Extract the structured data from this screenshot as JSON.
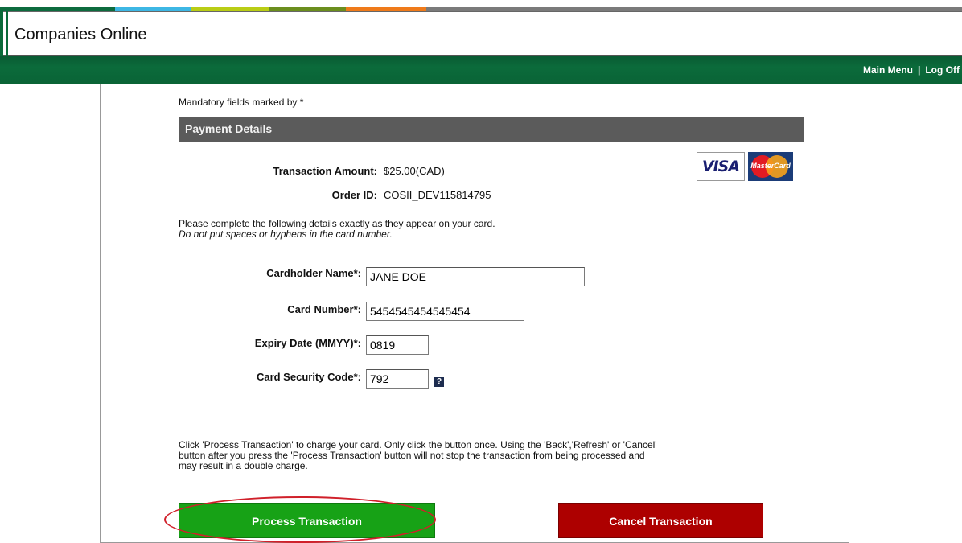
{
  "header": {
    "app_title": "Companies Online",
    "color_strip": [
      "#0d6b3e",
      "#3db7e4",
      "#b9cd15",
      "#6b8e1e",
      "#ef7a1a",
      "#7a7a7a"
    ]
  },
  "nav": {
    "main_menu": "Main Menu",
    "separator": "|",
    "log_off": "Log Off"
  },
  "form": {
    "mandatory_note": "Mandatory fields marked by *",
    "section_title": "Payment Details",
    "transaction_amount_label": "Transaction Amount:",
    "transaction_amount_value": "$25.00(CAD)",
    "order_id_label": "Order ID:",
    "order_id_value": "COSII_DEV115814795",
    "card_logos": [
      "VISA",
      "MasterCard"
    ],
    "instructions_line1": "Please complete the following details exactly as they appear on your card.",
    "instructions_line2": "Do not put spaces or hyphens in the card number.",
    "fields": [
      {
        "label": "Cardholder Name*:",
        "value": "JANE DOE"
      },
      {
        "label": "Card Number*:",
        "value": "5454545454545454"
      },
      {
        "label": "Expiry Date (MMYY)*:",
        "value": "0819"
      },
      {
        "label": "Card Security Code*:",
        "value": "792"
      }
    ],
    "help_icon_glyph": "?",
    "notice_line1": "Click 'Process Transaction' to charge your card. Only click the button once. Using the 'Back','Refresh' or 'Cancel'",
    "notice_line2": "button after you press the 'Process Transaction' button will not stop the transaction from being processed and",
    "notice_line3": "may result in a double charge.",
    "process_button": "Process Transaction",
    "cancel_button": "Cancel Transaction"
  },
  "colors": {
    "nav_green": "#0b6b3b",
    "section_gray": "#5b5b5b",
    "process_green": "#17a216",
    "cancel_red": "#ad0000",
    "highlight_red": "#d0202a"
  }
}
